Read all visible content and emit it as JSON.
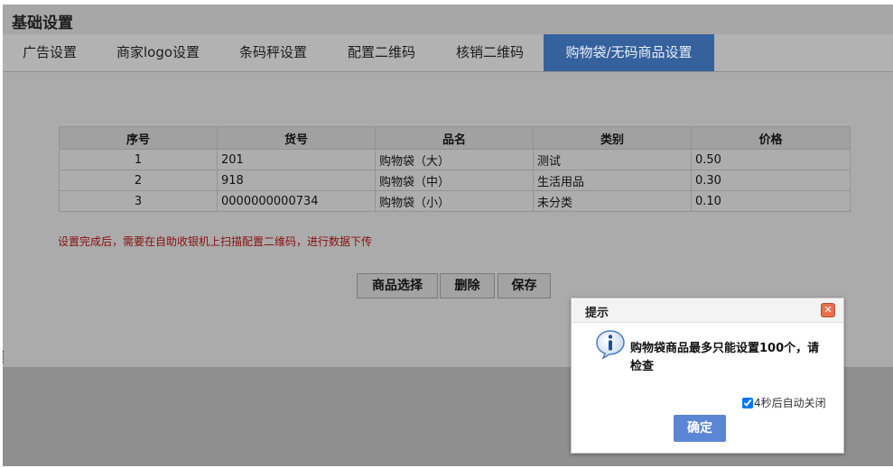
{
  "page_title": "基础设置",
  "tabs": [
    {
      "label": "广告设置",
      "active": false
    },
    {
      "label": "商家logo设置",
      "active": false
    },
    {
      "label": "条码秤设置",
      "active": false
    },
    {
      "label": "配置二维码",
      "active": false
    },
    {
      "label": "核销二维码",
      "active": false
    },
    {
      "label": "购物袋/无码商品设置",
      "active": true
    }
  ],
  "table": {
    "headers": [
      "序号",
      "货号",
      "品名",
      "类别",
      "价格"
    ],
    "rows": [
      [
        "1",
        "201",
        "购物袋（大）",
        "测试",
        "0.50"
      ],
      [
        "2",
        "918",
        "购物袋（中）",
        "生活用品",
        "0.30"
      ],
      [
        "3",
        "0000000000734",
        "购物袋（小）",
        "未分类",
        "0.10"
      ]
    ]
  },
  "notice": "设置完成后，需要在自助收银机上扫描配置二维码，进行数据下传",
  "buttons": {
    "select": "商品选择",
    "delete": "删除",
    "save": "保存"
  },
  "dialog": {
    "title": "提示",
    "message": "购物袋商品最多只能设置100个，请检查",
    "auto_close_label": "4秒后自动关闭",
    "auto_close_checked": true,
    "ok": "确定"
  },
  "colors": {
    "active_tab": "#35619d",
    "ok_button": "#5b85d5",
    "notice_text": "#8a0f0f",
    "close_button": "#e9704f"
  },
  "icons": {
    "dialog_icon": "info-icon",
    "close": "close-icon"
  }
}
